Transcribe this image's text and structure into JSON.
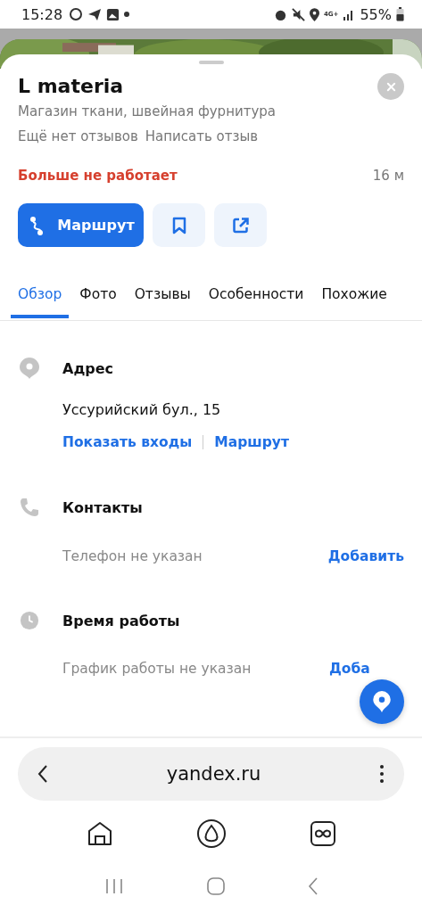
{
  "status_bar": {
    "time": "15:28",
    "battery": "55%",
    "network": "4G+"
  },
  "place": {
    "title": "L materia",
    "category": "Магазин ткани, швейная фурнитура",
    "reviews_text": "Ещё нет отзывов",
    "write_review": "Написать отзыв",
    "status": "Больше не работает",
    "distance": "16 м"
  },
  "actions": {
    "route": "Маршрут"
  },
  "tabs": [
    {
      "label": "Обзор",
      "selected": true
    },
    {
      "label": "Фото",
      "selected": false
    },
    {
      "label": "Отзывы",
      "selected": false
    },
    {
      "label": "Особенности",
      "selected": false
    },
    {
      "label": "Похожие",
      "selected": false
    }
  ],
  "sections": [
    {
      "kind": "address",
      "title": "Адрес",
      "value": "Уссурийский бул., 15",
      "links": [
        "Показать входы",
        "Маршрут"
      ]
    },
    {
      "kind": "contacts",
      "title": "Контакты",
      "empty_text": "Телефон не указан",
      "action": "Добавить"
    },
    {
      "kind": "hours",
      "title": "Время работы",
      "empty_text": "График работы не указан",
      "action": "Доба"
    }
  ],
  "browser": {
    "url": "yandex.ru"
  }
}
